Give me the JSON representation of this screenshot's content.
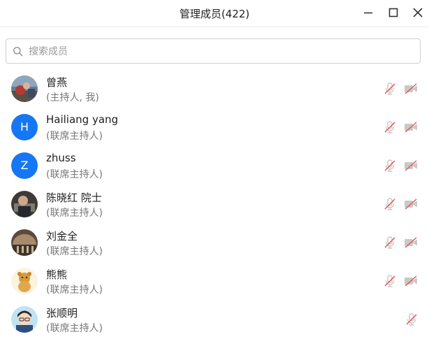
{
  "window": {
    "title": "管理成员(422)",
    "controls": [
      "minimize-icon",
      "maximize-icon",
      "close-icon"
    ]
  },
  "search": {
    "placeholder": "搜索成员",
    "value": "",
    "icon": "search-icon"
  },
  "colors": {
    "accent": "#1677f4",
    "muted_icon": "#c9c9c9",
    "slash_red": "#e5534b",
    "secondary_text": "#777777"
  },
  "members": [
    {
      "name": "曾燕",
      "role": "(主持人, 我)",
      "avatar": "photo-avatar",
      "mic": "mic-muted-icon",
      "camera": "camera-off-icon"
    },
    {
      "name": "Hailiang yang",
      "role": "(联席主持人)",
      "avatar_letter": "H",
      "mic": "mic-muted-icon",
      "camera": "camera-off-icon"
    },
    {
      "name": "zhuss",
      "role": "(联席主持人)",
      "avatar_letter": "Z",
      "mic": "mic-muted-icon",
      "camera": "camera-off-icon"
    },
    {
      "name": "陈晓红 院士",
      "role": "(联席主持人)",
      "avatar": "photo-avatar",
      "mic": "mic-muted-icon",
      "camera": "camera-off-icon"
    },
    {
      "name": "刘金全",
      "role": "(联席主持人)",
      "avatar": "photo-avatar",
      "mic": "mic-muted-icon",
      "camera": "camera-off-icon"
    },
    {
      "name": "熊熊",
      "role": "(联席主持人)",
      "avatar": "photo-avatar",
      "mic": "mic-muted-icon",
      "camera": "camera-off-icon"
    },
    {
      "name": "张顺明",
      "role": "(联席主持人)",
      "avatar": "cartoon-avatar",
      "mic": "mic-muted-icon"
    }
  ]
}
